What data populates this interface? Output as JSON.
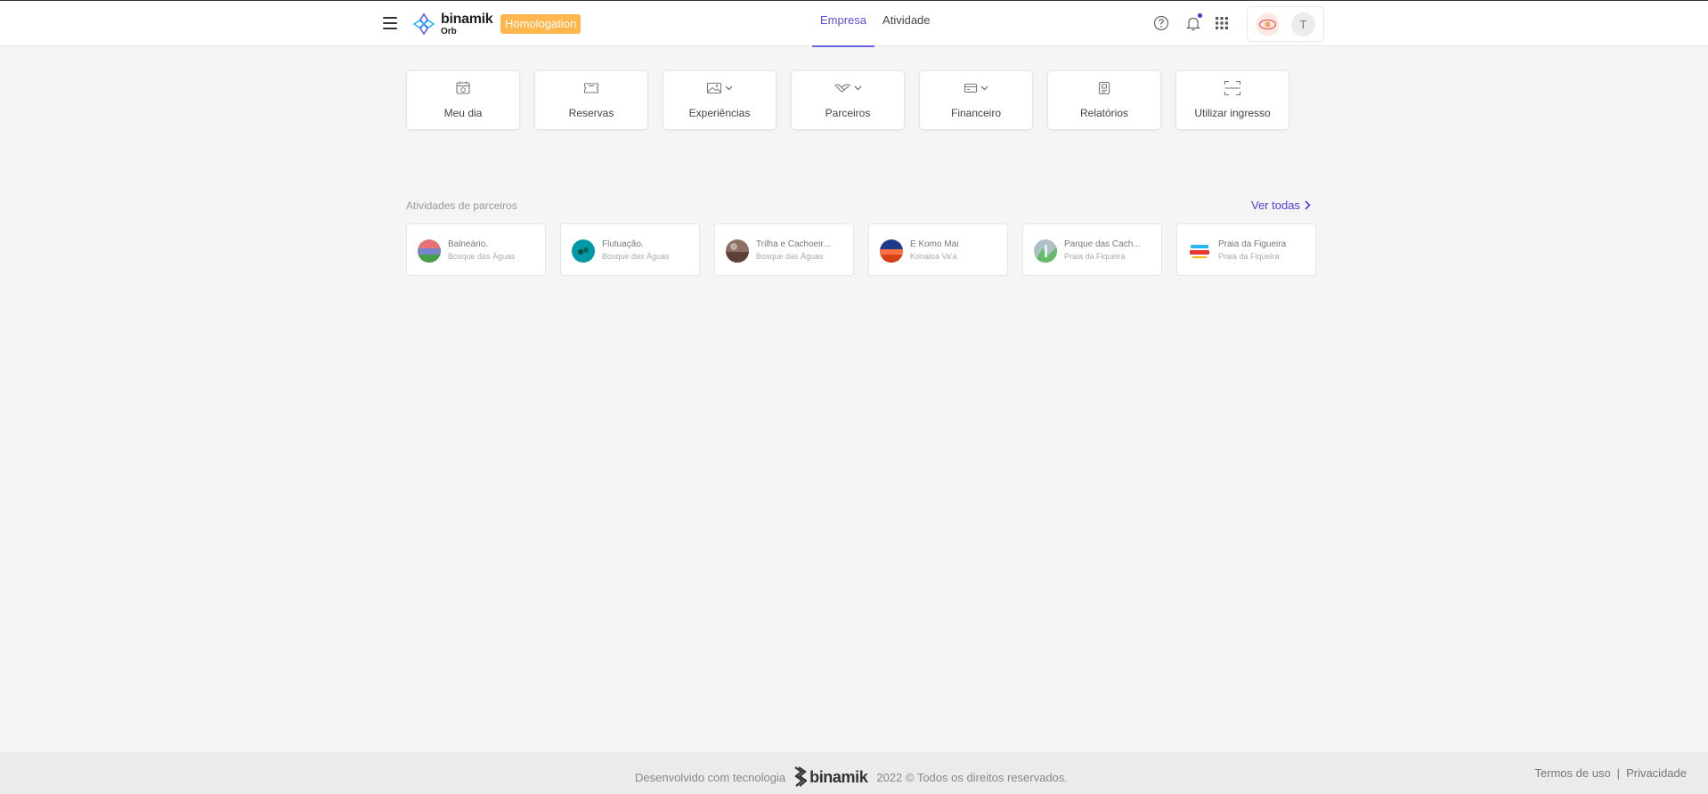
{
  "header": {
    "logo_name": "binamik",
    "logo_sub": "Orb",
    "env_badge": "Homologation",
    "tabs": [
      {
        "label": "Empresa",
        "active": true
      },
      {
        "label": "Atividade",
        "active": false
      }
    ],
    "user_initial": "T",
    "accent_color": "#5b4ed8",
    "badge_color": "#ffb74d"
  },
  "menu": {
    "items": [
      {
        "label": "Meu dia",
        "icon": "calendar-icon"
      },
      {
        "label": "Reservas",
        "icon": "ticket-icon"
      },
      {
        "label": "Experiências",
        "icon": "image-icon",
        "dropdown": true
      },
      {
        "label": "Parceiros",
        "icon": "handshake-icon",
        "dropdown": true
      },
      {
        "label": "Financeiro",
        "icon": "wallet-icon",
        "dropdown": true
      },
      {
        "label": "Relatórios",
        "icon": "report-icon"
      },
      {
        "label": "Utilizar ingresso",
        "icon": "scan-icon"
      }
    ]
  },
  "partners": {
    "title": "Atividades de parceiros",
    "see_all": "Ver todas",
    "items": [
      {
        "name": "Balneário.",
        "sub": "Bosque das Águas"
      },
      {
        "name": "Flutuação.",
        "sub": "Bosque das Águas"
      },
      {
        "name": "Trilha e Cachoeir...",
        "sub": "Bosque das Águas"
      },
      {
        "name": "E Komo Mai",
        "sub": "Konaloa Va'a"
      },
      {
        "name": "Parque das Cach...",
        "sub": "Praia da Fiqueira"
      },
      {
        "name": "Praia da Figueira",
        "sub": "Praia da Fiqueira"
      }
    ]
  },
  "footer": {
    "developed_with": "Desenvolvido com tecnologia",
    "logo_text": "binamik",
    "copyright": "2022 © Todos os direitos reservados.",
    "terms": "Termos de uso",
    "separator": "|",
    "privacy": "Privacidade"
  }
}
